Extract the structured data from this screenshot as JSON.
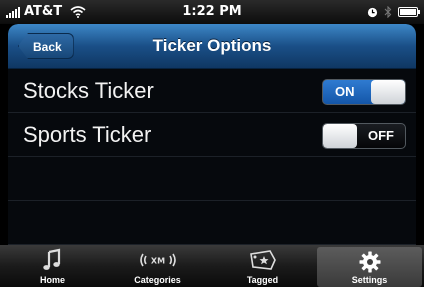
{
  "status_bar": {
    "carrier": "AT&T",
    "time": "1:22 PM"
  },
  "nav": {
    "back_label": "Back",
    "title": "Ticker Options"
  },
  "settings": [
    {
      "label": "Stocks Ticker",
      "state": "ON"
    },
    {
      "label": "Sports Ticker",
      "state": "OFF"
    }
  ],
  "tabs": [
    {
      "label": "Home",
      "icon": "music-note-icon"
    },
    {
      "label": "Categories",
      "icon": "xm-logo-icon"
    },
    {
      "label": "Tagged",
      "icon": "tag-star-icon"
    },
    {
      "label": "Settings",
      "icon": "gear-icon",
      "selected": true
    }
  ],
  "colors": {
    "nav_blue": "#1a4f87",
    "toggle_on": "#1e67bd",
    "background": "#06090d"
  }
}
